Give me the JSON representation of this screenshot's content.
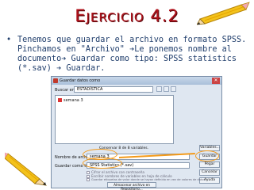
{
  "slide": {
    "title": "Ejercicio 4.2",
    "bullet": "•",
    "lines": [
      "Tenemos que guardar el archivo en formato SPSS.",
      "Pinchamos en \"Archivo\" ➔Le ponemos nombre al",
      "documento➔ Guardar como tipo: SPSS statistics",
      "(*.sav) ➔ Guardar."
    ]
  },
  "dialog": {
    "title": "Guardar datos como",
    "look_in_label": "Buscar en:",
    "look_in_value": "ESTADÍSTICA",
    "file_item": "semana 3",
    "keeping_text": "Conservar 8 de 8 variables.",
    "variables_button": "Variables...",
    "file_name_label": "Nombre de archivo:",
    "file_name_value": "semana 3",
    "file_type_label": "Guardar como tipo:",
    "file_type_value": "SPSS Statistics (*.sav)",
    "options": [
      "Cifrar el archivo con contraseña",
      "Escribir nombres de variables en hoja de cálculo",
      "Guardar etiquetas de valor donde se hayan definido en vez de valores de datos",
      "Guardar etiquetas de valor en archivo .sas"
    ],
    "buttons": [
      "Guardar",
      "Pegar",
      "Cancelar",
      "Ayuda"
    ],
    "repository_button": "Almacenar archivo en Repositorio..."
  }
}
